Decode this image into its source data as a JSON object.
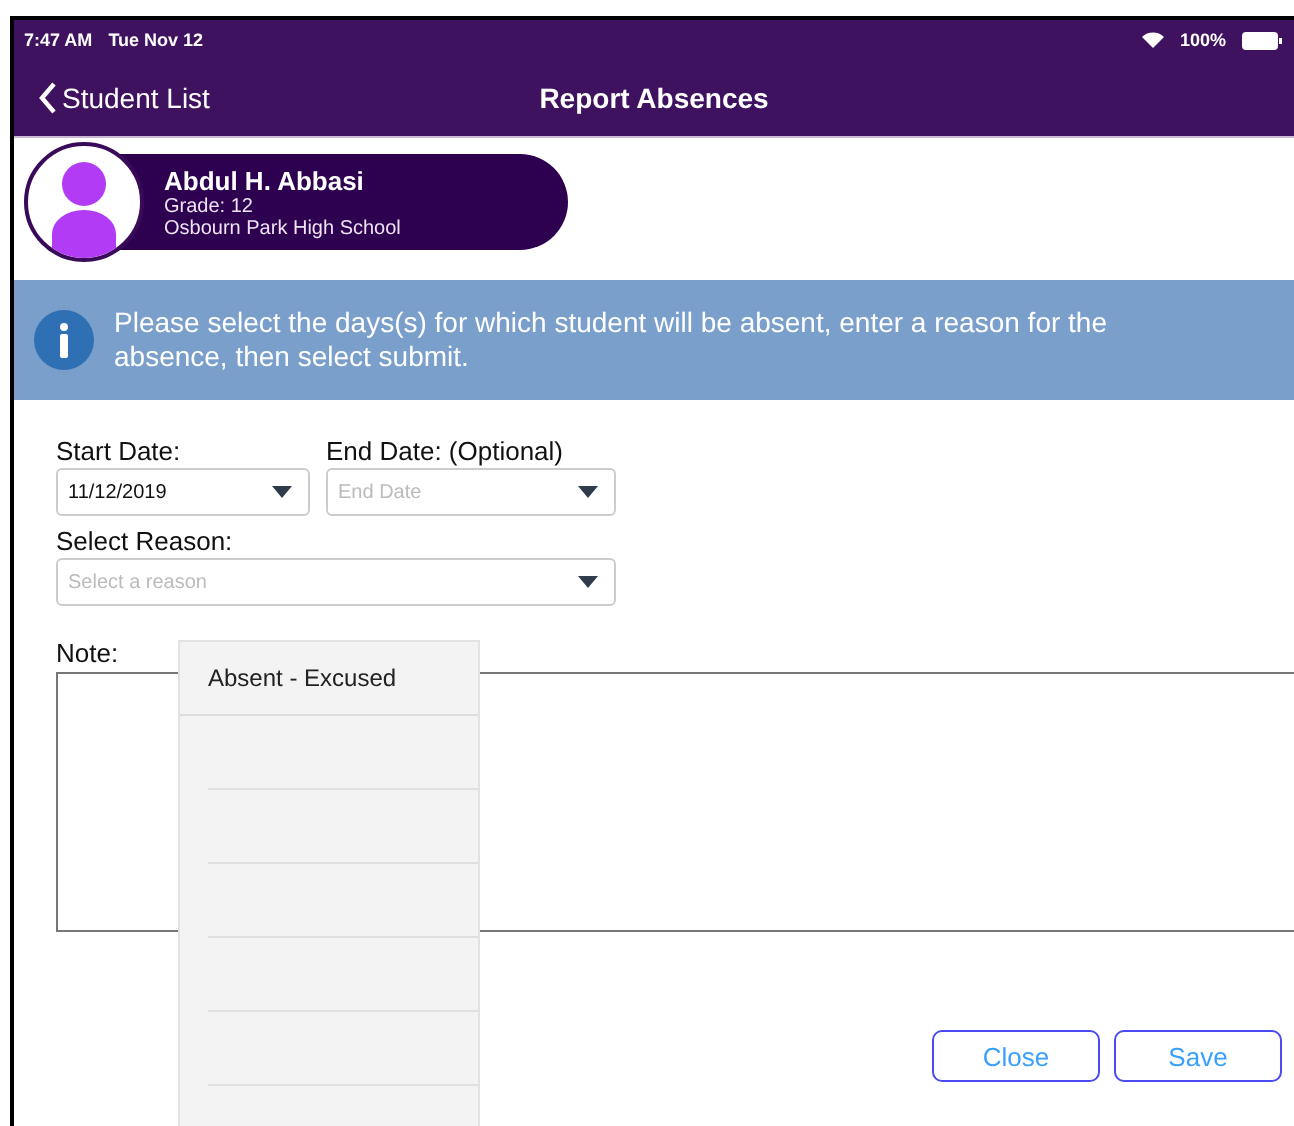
{
  "status_bar": {
    "time": "7:47 AM",
    "date": "Tue Nov 12",
    "battery": "100%"
  },
  "nav": {
    "back": "Student List",
    "title": "Report Absences"
  },
  "student": {
    "name": "Abdul H. Abbasi",
    "grade": "Grade: 12",
    "school": "Osbourn Park High School"
  },
  "info": "Please select the days(s) for which student will be absent, enter a reason for the absence, then select submit.",
  "form": {
    "start": {
      "label": "Start Date:",
      "value": "11/12/2019"
    },
    "end": {
      "label": "End Date: (Optional)",
      "placeholder": "End Date"
    },
    "reason": {
      "label": "Select Reason:",
      "placeholder": "Select a reason",
      "expanded": true
    },
    "note": {
      "label": "Note:"
    }
  },
  "reason_options": [
    "Absent - Excused"
  ],
  "buttons": [
    "Close",
    "Save"
  ]
}
